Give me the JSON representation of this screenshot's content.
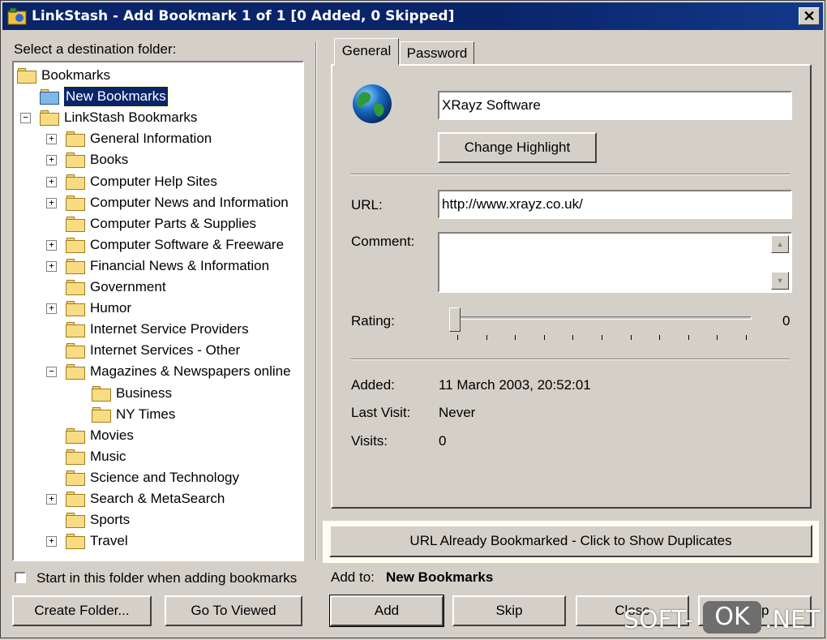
{
  "window": {
    "title": "LinkStash - Add Bookmark 1 of 1  [0 Added, 0 Skipped]",
    "close_glyph": "✕"
  },
  "left": {
    "destination_label": "Select a destination folder:",
    "tree": [
      {
        "label": "Bookmarks",
        "expander": ""
      },
      {
        "label": "New Bookmarks",
        "expander": "",
        "selected": true
      },
      {
        "label": "LinkStash Bookmarks",
        "expander": "−"
      },
      {
        "label": "General Information",
        "expander": "+"
      },
      {
        "label": "Books",
        "expander": "+"
      },
      {
        "label": "Computer Help Sites",
        "expander": "+"
      },
      {
        "label": "Computer News and Information",
        "expander": "+"
      },
      {
        "label": "Computer Parts & Supplies",
        "expander": ""
      },
      {
        "label": "Computer Software & Freeware",
        "expander": "+"
      },
      {
        "label": "Financial News & Information",
        "expander": "+"
      },
      {
        "label": "Government",
        "expander": ""
      },
      {
        "label": "Humor",
        "expander": "+"
      },
      {
        "label": "Internet Service Providers",
        "expander": ""
      },
      {
        "label": "Internet Services - Other",
        "expander": ""
      },
      {
        "label": "Magazines & Newspapers online",
        "expander": "−"
      },
      {
        "label": "Business",
        "expander": ""
      },
      {
        "label": "NY Times",
        "expander": ""
      },
      {
        "label": "Movies",
        "expander": ""
      },
      {
        "label": "Music",
        "expander": ""
      },
      {
        "label": "Science and Technology",
        "expander": ""
      },
      {
        "label": "Search & MetaSearch",
        "expander": "+"
      },
      {
        "label": "Sports",
        "expander": ""
      },
      {
        "label": "Travel",
        "expander": "+"
      }
    ],
    "start_folder_checkbox": "Start in this folder when adding bookmarks",
    "start_folder_checked": false,
    "create_folder_button": "Create Folder...",
    "go_to_viewed_button": "Go To Viewed"
  },
  "right": {
    "tabs": [
      "General",
      "Password"
    ],
    "active_tab": "General",
    "title_value": "XRayz Software",
    "change_highlight_button": "Change Highlight",
    "url_label": "URL:",
    "url_value": "http://www.xrayz.co.uk/",
    "comment_label": "Comment:",
    "comment_value": "",
    "rating_label": "Rating:",
    "rating_value": "0",
    "added_label": "Added:",
    "added_value": "11 March 2003, 20:52:01",
    "last_visit_label": "Last Visit:",
    "last_visit_value": "Never",
    "visits_label": "Visits:",
    "visits_value": "0",
    "duplicates_button": "URL Already Bookmarked - Click to Show Duplicates",
    "add_to_label": "Add to:",
    "add_to_value": "New Bookmarks",
    "add_button": "Add",
    "skip_button": "Skip",
    "close_button": "Close",
    "help_button": "Help"
  },
  "watermark": {
    "left": "SOFT-",
    "mid": "OK",
    "right": ".NET"
  },
  "colors": {
    "title_bar": "#0a246a",
    "selection": "#0a246a",
    "face": "#d4d0c8"
  }
}
